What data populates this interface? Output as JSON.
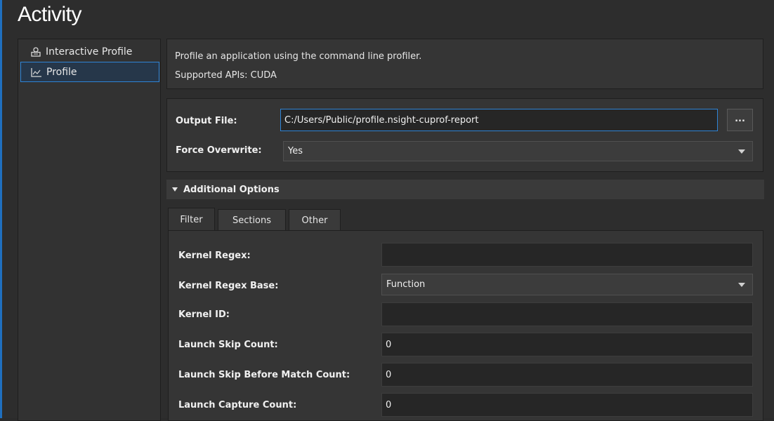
{
  "title": "Activity",
  "sidebar": {
    "items": [
      {
        "label": "Interactive Profile",
        "icon": "interactive-profile-icon",
        "selected": false
      },
      {
        "label": "Profile",
        "icon": "profile-chart-icon",
        "selected": true
      }
    ]
  },
  "description": {
    "line1": "Profile an application using the command line profiler.",
    "line2": "Supported APIs: CUDA"
  },
  "output": {
    "file_label": "Output File:",
    "file_value": "C:/Users/Public/profile.nsight-cuprof-report",
    "browse_label": "...",
    "overwrite_label": "Force Overwrite:",
    "overwrite_value": "Yes"
  },
  "additional_options": {
    "header": "Additional Options",
    "tabs": [
      {
        "label": "Filter",
        "active": true
      },
      {
        "label": "Sections",
        "active": false
      },
      {
        "label": "Other",
        "active": false
      }
    ],
    "fields": {
      "kernel_regex": {
        "label": "Kernel Regex:",
        "value": ""
      },
      "kernel_regex_base": {
        "label": "Kernel Regex Base:",
        "value": "Function"
      },
      "kernel_id": {
        "label": "Kernel ID:",
        "value": ""
      },
      "launch_skip_count": {
        "label": "Launch Skip Count:",
        "value": "0"
      },
      "launch_skip_before_match_count": {
        "label": "Launch Skip Before Match Count:",
        "value": "0"
      },
      "launch_capture_count": {
        "label": "Launch Capture Count:",
        "value": "0"
      }
    }
  },
  "colors": {
    "accent": "#2f84d6",
    "background": "#2d2d2d",
    "panel": "#353535",
    "input": "#262626"
  }
}
